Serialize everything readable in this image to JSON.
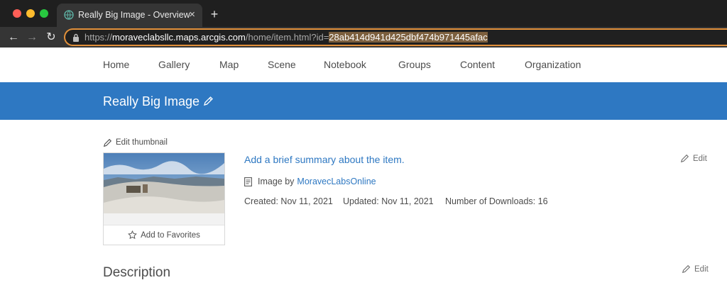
{
  "browser": {
    "tab_title": "Really Big Image - Overview",
    "tab_close": "×",
    "new_tab": "+",
    "url_prefix": "https://",
    "url_host": "moraveclabsllc.maps.arcgis.com",
    "url_path": "/home/item.html?id=",
    "url_selected": "28ab414d941d425dbf474b971445afac",
    "back_glyph": "←",
    "forward_glyph": "→",
    "reload_glyph": "↻"
  },
  "nav": {
    "items": [
      "Home",
      "Gallery",
      "Map",
      "Scene",
      "Notebook",
      "Groups",
      "Content",
      "Organization"
    ]
  },
  "item": {
    "title": "Really Big Image",
    "edit_thumbnail": "Edit thumbnail",
    "add_to_favorites": "Add to Favorites",
    "summary": "Add a brief summary about the item.",
    "type_prefix": "Image by",
    "owner": "MoravecLabsOnline",
    "created": "Created: Nov 11, 2021",
    "updated": "Updated: Nov 11, 2021",
    "downloads": "Number of Downloads: 16",
    "edit": "Edit"
  },
  "description": {
    "title": "Description",
    "edit": "Edit"
  },
  "icons": {
    "favicon": "globe-icon",
    "lock": "lock-icon",
    "pencil": "pencil-icon",
    "star": "star-icon",
    "document": "document-icon"
  },
  "colors": {
    "brand_blue": "#2e78c2",
    "omnibox_focus": "#e2903a"
  }
}
